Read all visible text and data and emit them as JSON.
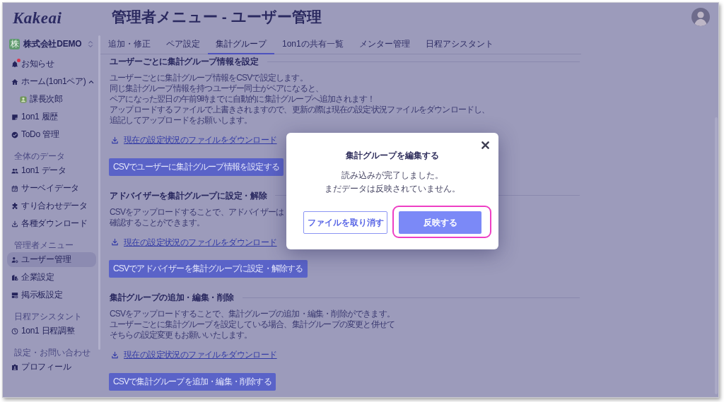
{
  "sidebar": {
    "logo": "Kakeai",
    "company": {
      "badge": "株",
      "name": "株式会社DEMO"
    },
    "groups": [
      {
        "items": [
          {
            "label": "お知らせ",
            "selected": false,
            "unread": true
          },
          {
            "label": "ホーム(1on1ペア)",
            "selected": false,
            "unread": false,
            "expanded": true,
            "children": [
              {
                "label": "課長次郎",
                "selected": false
              }
            ]
          },
          {
            "label": "1on1 履歴",
            "selected": false,
            "unread": false
          },
          {
            "label": "ToDo 管理",
            "selected": false,
            "unread": false
          }
        ]
      },
      {
        "title": "全体のデータ",
        "items": [
          {
            "label": "1on1 データ",
            "selected": false
          },
          {
            "label": "サーベイデータ",
            "selected": false
          },
          {
            "label": "すり合わせデータ",
            "selected": false
          },
          {
            "label": "各種ダウンロード",
            "selected": false
          }
        ]
      },
      {
        "title": "管理者メニュー",
        "items": [
          {
            "label": "ユーザー管理",
            "selected": true
          },
          {
            "label": "企業設定",
            "selected": false
          },
          {
            "label": "掲示板設定",
            "selected": false
          }
        ]
      },
      {
        "title": "日程アシスタント",
        "items": [
          {
            "label": "1on1 日程調整",
            "selected": false
          }
        ]
      },
      {
        "title": "設定・お問い合わせ",
        "items": [
          {
            "label": "プロフィール",
            "selected": false
          }
        ]
      }
    ]
  },
  "header": {
    "title": "管理者メニュー - ユーザー管理"
  },
  "tabs": [
    {
      "label": "追加・修正",
      "selected": false
    },
    {
      "label": "ペア設定",
      "selected": false
    },
    {
      "label": "集計グループ",
      "selected": true
    },
    {
      "label": "1on1の共有一覧",
      "selected": false
    },
    {
      "label": "メンター管理",
      "selected": false
    },
    {
      "label": "日程アシスタント",
      "selected": false
    }
  ],
  "sections": [
    {
      "heading": "ユーザーごとに集計グループ情報を設定",
      "lines": [
        "ユーザーごとに集計グループ情報をCSVで設定します。",
        "同じ集計グループ情報を持つユーザー同士がペアになると、",
        "ペアになった翌日の午前9時までに自動的に集計グループへ追加されます！",
        "アップロードするファイルで上書きされますので、更新の際は現在の設定状況ファイルをダウンロードし、",
        "追記してアップロードをお願いします。"
      ],
      "download_link": "現在の設定状況のファイルをダウンロード",
      "button": "CSVでユーザーに集計グループ情報を設定する"
    },
    {
      "heading": "アドバイザーを集計グループに設定・解除",
      "lines": [
        "CSVをアップロードすることで、アドバイザーは",
        "確認することができます。"
      ],
      "download_link": "現在の設定状況のファイルをダウンロード",
      "button": "CSVでアドバイザーを集計グループに設定・解除する"
    },
    {
      "heading": "集計グループの追加・編集・削除",
      "lines": [
        "CSVをアップロードすることで、集計グループの追加・編集・削除ができます。",
        "ユーザーごとに集計グループを設定している場合、集計グループの変更と併せて",
        "そちらの設定変更もお願いいたします。"
      ],
      "download_link": "現在の設定状況のファイルをダウンロード",
      "button": "CSVで集計グループを追加・編集・削除する"
    }
  ],
  "dialog": {
    "title": "集計グループを編集する",
    "message": [
      "読み込みが完了しました。",
      "まだデータは反映されていません。"
    ],
    "buttons": [
      {
        "label": "ファイルを取り消す",
        "kind": "secondary",
        "highlighted": false
      },
      {
        "label": "反映する",
        "kind": "primary",
        "highlighted": true
      }
    ]
  }
}
